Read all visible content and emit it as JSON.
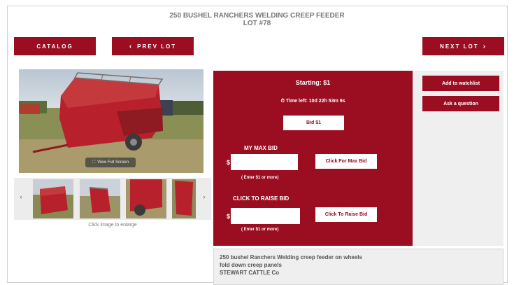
{
  "header": {
    "title": "250 BUSHEL RANCHERS WELDING CREEP FEEDER",
    "lot": "LOT #78"
  },
  "nav": {
    "catalog": "CATALOG",
    "prev": "PREV LOT",
    "next": "NEXT LOT"
  },
  "gallery": {
    "view_full": "View Full Screen",
    "caption": "Click image to enlarge",
    "thumbnail_count": 4
  },
  "bid_panel": {
    "starting": "Starting: $1",
    "time_left": "Time left: 10d 22h 53m 9s",
    "bid_button": "Bid $1",
    "max_bid_heading": "MY MAX BID",
    "currency": "$",
    "max_bid_value": "",
    "max_bid_button": "Click For Max Bid",
    "hint": "( Enter $1 or more)",
    "raise_heading": "CLICK TO RAISE BID",
    "raise_value": "",
    "raise_button": "Click To Raise Bid"
  },
  "side": {
    "watchlist": "Add to watchlist",
    "question": "Ask a question"
  },
  "description": [
    "250 bushel Ranchers Welding creep feeder on wheels",
    "fold down creep panels",
    "STEWART CATTLE Co"
  ],
  "colors": {
    "accent": "#9b0e22",
    "panel_bg": "#efefef"
  },
  "icons": {
    "prev": "chevron-left-icon",
    "next": "chevron-right-icon",
    "timer": "timer-icon"
  }
}
